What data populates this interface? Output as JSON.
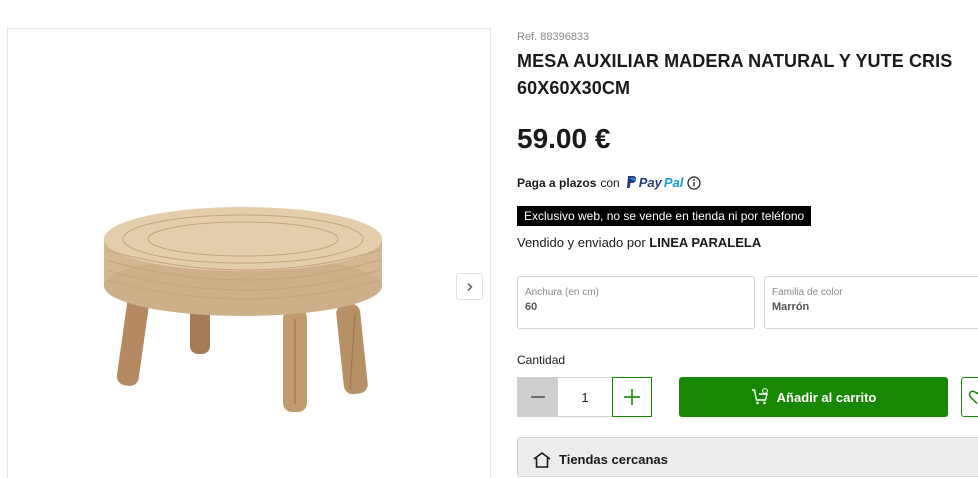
{
  "product": {
    "ref": "Ref. 88396833",
    "title": "MESA AUXILIAR MADERA NATURAL Y YUTE CRIS 60X60X30CM",
    "price": "59.00 €",
    "image_alt": "Mesa auxiliar redonda de yute con patas de madera"
  },
  "payment": {
    "prefix": "Paga a plazos",
    "con": "con",
    "paypal_a": "Pay",
    "paypal_b": "Pal",
    "info_icon": "info-icon"
  },
  "notice": "Exclusivo web, no se vende en tienda ni por teléfono",
  "seller": {
    "prefix": "Vendido y enviado por",
    "name": "LINEA PARALELA"
  },
  "attributes": [
    {
      "label": "Anchura (en cm)",
      "value": "60"
    },
    {
      "label": "Familia de color",
      "value": "Marrón"
    }
  ],
  "quantity": {
    "label": "Cantidad",
    "value": "1"
  },
  "actions": {
    "add_to_cart": "Añadir al carrito",
    "cart_icon": "cart-plus-icon",
    "wishlist_icon": "heart-icon"
  },
  "stores": {
    "label": "Tiendas cercanas",
    "icon": "store-icon"
  },
  "colors": {
    "brand_green": "#188803",
    "notice_bg": "#000000"
  }
}
